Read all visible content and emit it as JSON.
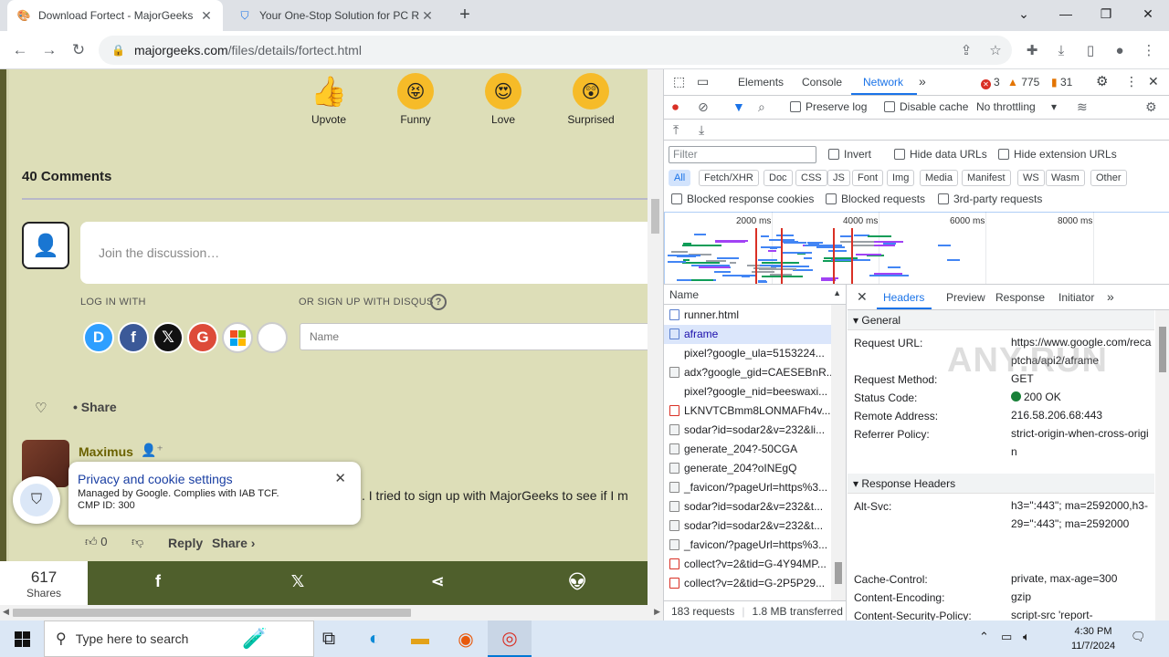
{
  "browser": {
    "tabs": [
      {
        "title": "Download Fortect - MajorGeeks"
      },
      {
        "title": "Your One-Stop Solution for PC R"
      }
    ],
    "url_host": "majorgeeks.com",
    "url_path": "/files/details/fortect.html"
  },
  "page": {
    "reactions": [
      {
        "label": "Upvote",
        "icon": "thumbs-up-emoji"
      },
      {
        "label": "Funny",
        "icon": "tongue-out-emoji"
      },
      {
        "label": "Love",
        "icon": "heart-eyes-emoji"
      },
      {
        "label": "Surprised",
        "icon": "surprised-emoji"
      }
    ],
    "comments_count": "40 Comments",
    "discussion_placeholder": "Join the discussion…",
    "login_with": "LOG IN WITH",
    "signup_with": "OR SIGN UP WITH DISQUS",
    "name_placeholder": "Name",
    "share_label": "Share",
    "comment": {
      "author": "Maximus",
      "text": ". I tried to sign up with MajorGeeks to see if I m",
      "upvotes": "0",
      "reply_label": "Reply",
      "share_label": "Share ›"
    },
    "privacy": {
      "title": "Privacy and cookie settings",
      "line1": "Managed by Google. Complies with IAB TCF.",
      "line2": "CMP ID: 300"
    },
    "sharebar": {
      "count": "617",
      "count_label": "Shares"
    }
  },
  "devtools": {
    "tabs": [
      "Elements",
      "Console",
      "Network"
    ],
    "errors": "3",
    "warnings": "775",
    "issues": "31",
    "preserve_log": "Preserve log",
    "disable_cache": "Disable cache",
    "throttling": "No throttling",
    "filter_placeholder": "Filter",
    "invert": "Invert",
    "hide_data_urls": "Hide data URLs",
    "hide_extension_urls": "Hide extension URLs",
    "filter_types": [
      "All",
      "Fetch/XHR",
      "Doc",
      "CSS",
      "JS",
      "Font",
      "Img",
      "Media",
      "Manifest",
      "WS",
      "Wasm",
      "Other"
    ],
    "blocked_cookies": "Blocked response cookies",
    "blocked_requests": "Blocked requests",
    "third_party": "3rd-party requests",
    "timeline_ticks": [
      "2000 ms",
      "4000 ms",
      "6000 ms",
      "8000 ms"
    ],
    "name_col": "Name",
    "requests": [
      "runner.html",
      "aframe",
      "pixel?google_ula=5153224...",
      "adx?google_gid=CAESEBnR...",
      "pixel?google_nid=beeswaxi...",
      "LKNVTCBmm8LONMAFh4v...",
      "sodar?id=sodar2&v=232&li...",
      "generate_204?-50CGA",
      "generate_204?oINEgQ",
      "_favicon/?pageUrl=https%3...",
      "sodar?id=sodar2&v=232&t...",
      "sodar?id=sodar2&v=232&t...",
      "_favicon/?pageUrl=https%3...",
      "collect?v=2&tid=G-4Y94MP...",
      "collect?v=2&tid=G-2P5P29..."
    ],
    "status_requests": "183 requests",
    "status_transferred": "1.8 MB transferred",
    "detail_tabs": [
      "Headers",
      "Preview",
      "Response",
      "Initiator"
    ],
    "general_label": "General",
    "general": [
      {
        "k": "Request URL:",
        "v": "https://www.google.com/recaptcha/api2/aframe"
      },
      {
        "k": "Request Method:",
        "v": "GET"
      },
      {
        "k": "Status Code:",
        "v": "200 OK"
      },
      {
        "k": "Remote Address:",
        "v": "216.58.206.68:443"
      },
      {
        "k": "Referrer Policy:",
        "v": "strict-origin-when-cross-origin"
      }
    ],
    "response_headers_label": "Response Headers",
    "response_headers": [
      {
        "k": "Alt-Svc:",
        "v": "h3=\":443\"; ma=2592000,h3-29=\":443\"; ma=2592000"
      },
      {
        "k": "Cache-Control:",
        "v": "private, max-age=300"
      },
      {
        "k": "Content-Encoding:",
        "v": "gzip"
      },
      {
        "k": "Content-Security-Policy:",
        "v": "script-src 'report-"
      }
    ],
    "watermark": "ANY.RUN"
  },
  "taskbar": {
    "search_placeholder": "Type here to search",
    "time": "4:30 PM",
    "date": "11/7/2024"
  },
  "colors": {
    "page_bg": "#dddeb8",
    "sharebar": "#4f5f2c",
    "accent": "#1a73e8"
  }
}
